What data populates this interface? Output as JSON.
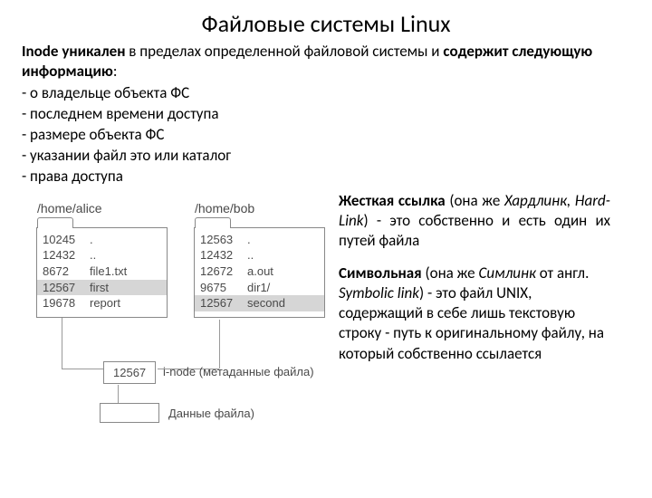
{
  "title": "Файловые системы Linux",
  "intro_html_parts": {
    "p1a": "Inode уникален",
    "p1b": " в пределах определенной файловой системы и ",
    "p1c": "содержит следующую информацию",
    "p1d": ":"
  },
  "bullets": [
    "- о владельце объекта ФС",
    "- последнем времени доступа",
    "- размере объекта ФС",
    "- указании файл это или каталог",
    "- права доступа"
  ],
  "diagram": {
    "alice_path": "/home/alice",
    "bob_path": "/home/bob",
    "alice_rows": [
      {
        "inode": "10245",
        "name": "."
      },
      {
        "inode": "12432",
        "name": ".."
      },
      {
        "inode": "8672",
        "name": "file1.txt"
      },
      {
        "inode": "12567",
        "name": "first",
        "hl": true
      },
      {
        "inode": "19678",
        "name": "report"
      }
    ],
    "bob_rows": [
      {
        "inode": "12563",
        "name": "."
      },
      {
        "inode": "12432",
        "name": ".."
      },
      {
        "inode": "12672",
        "name": "a.out"
      },
      {
        "inode": "9675",
        "name": "dir1/"
      },
      {
        "inode": "12567",
        "name": "second",
        "hl": true
      }
    ],
    "inode_box": "12567",
    "inode_caption": "i-node (метаданные файла)",
    "data_caption": "Данные файла)"
  },
  "hardlink": {
    "b": "Жесткая ссылка",
    "mid": " (она же ",
    "i": "Хардлинк, Hard-Link",
    "rest": ") - это собственно и есть один их путей файла"
  },
  "symlink": {
    "b": "Символьная",
    "mid": " (она же ",
    "i": "Симлинк",
    "mid2": " от англ. ",
    "i2": "Symbolic link",
    "rest": ") - это файл UNIX, содержащий в себе лишь текстовую строку - путь к оригинальному файлу, на который собственно ссылается"
  }
}
